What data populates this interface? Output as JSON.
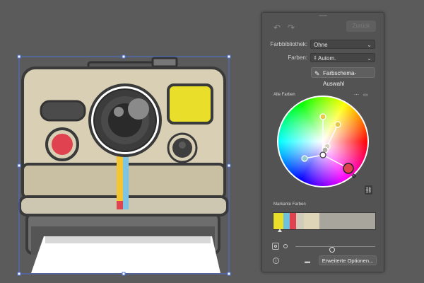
{
  "toolbar": {
    "reset_label": "Zurück"
  },
  "library": {
    "label": "Farbbibliothek:",
    "value": "Ohne"
  },
  "colors": {
    "label": "Farben:",
    "value": "Autom."
  },
  "scheme_button": {
    "label": "Farbschema-Auswahl"
  },
  "all_colors": {
    "label": "Alle Farben"
  },
  "prominent": {
    "label": "Markante Farben"
  },
  "advanced_button": {
    "label": "Erweiterte Optionen..."
  },
  "swatches": [
    {
      "color": "#e9df2a",
      "weight": 10
    },
    {
      "color": "#6ec1dd",
      "weight": 6
    },
    {
      "color": "#e0434f",
      "weight": 6
    },
    {
      "color": "#d1cbb9",
      "weight": 8
    },
    {
      "color": "#ded4b8",
      "weight": 15
    },
    {
      "color": "#a8a69c",
      "weight": 55
    }
  ],
  "slider": {
    "value": 0.45
  },
  "camera_colors": {
    "body": "#d8cfb4",
    "outline": "#3a3a3a",
    "flash": "#e9df2a",
    "red_button": "#e0434f",
    "stripe_yellow": "#f2c531",
    "stripe_blue": "#7fc3e3",
    "stripe_red": "#e0434f",
    "bottom": "#6d6d6d"
  }
}
